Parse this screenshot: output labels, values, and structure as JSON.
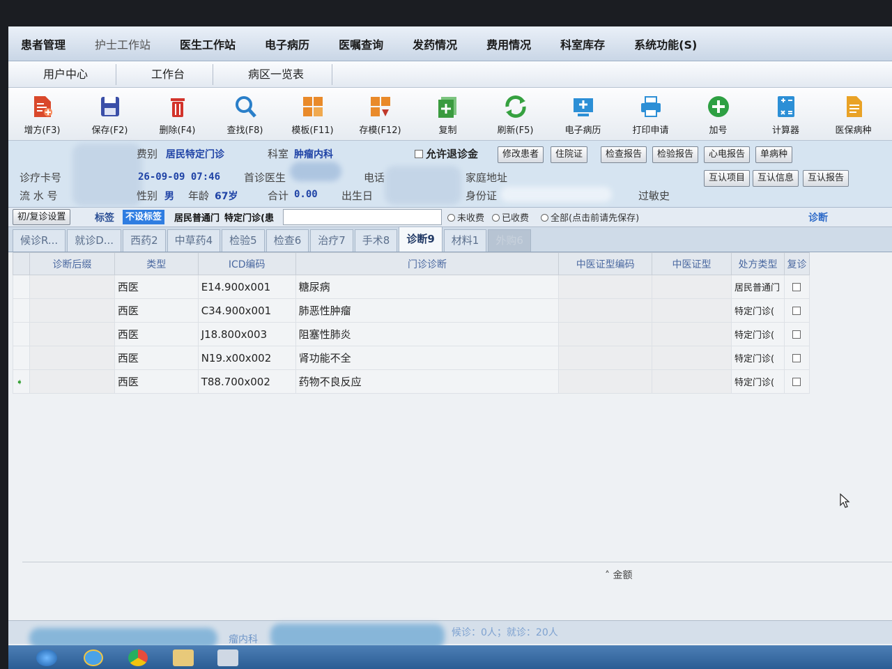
{
  "menu": {
    "items": [
      "患者管理",
      "护士工作站",
      "医生工作站",
      "电子病历",
      "医嘱查询",
      "发药情况",
      "费用情况",
      "科室库存",
      "系统功能(S)"
    ]
  },
  "subtabs": [
    "用户中心",
    "工作台",
    "病区一览表"
  ],
  "toolbar": [
    {
      "label": "增方(F3)",
      "icon": "add-prescription-icon",
      "color": "#d9482b"
    },
    {
      "label": "保存(F2)",
      "icon": "save-icon",
      "color": "#3b4fa8"
    },
    {
      "label": "删除(F4)",
      "icon": "delete-trash-icon",
      "color": "#d2332b"
    },
    {
      "label": "查找(F8)",
      "icon": "search-icon",
      "color": "#2a7fc9"
    },
    {
      "label": "模板(F11)",
      "icon": "template-icon",
      "color": "#e98a2a"
    },
    {
      "label": "存模(F12)",
      "icon": "save-template-icon",
      "color": "#e98a2a"
    },
    {
      "label": "复制",
      "icon": "copy-icon",
      "color": "#3a9b3f"
    },
    {
      "label": "刷新(F5)",
      "icon": "refresh-icon",
      "color": "#36a140"
    },
    {
      "label": "电子病历",
      "icon": "emr-icon",
      "color": "#2c8fd6"
    },
    {
      "label": "打印申请",
      "icon": "printer-icon",
      "color": "#2c8fd6"
    },
    {
      "label": "加号",
      "icon": "plus-circle-icon",
      "color": "#2ea043"
    },
    {
      "label": "计算器",
      "icon": "calculator-icon",
      "color": "#2c8fd6"
    },
    {
      "label": "医保病种",
      "icon": "insurance-doc-icon",
      "color": "#e9a226"
    }
  ],
  "patient": {
    "fee_type_label": "费别",
    "fee_type_value": "居民特定门诊",
    "dept_label": "科室",
    "dept_value": "肿瘤内科",
    "allow_refund_label": "允许退诊金",
    "card_label": "诊疗卡号",
    "serial_label": "流 水 号",
    "visit_time": "26-09-09 07:46",
    "first_doctor_label": "首诊医生",
    "phone_label": "电话",
    "address_label": "家庭地址",
    "gender_label": "性别",
    "gender_value": "男",
    "age_label": "年龄",
    "age_value": "67岁",
    "total_label": "合计",
    "total_value": "0.00",
    "birth_label": "出生日",
    "id_label": "身份证",
    "allergy_label": "过敏史",
    "buttons_row1": [
      "修改患者",
      "住院证",
      "检查报告",
      "检验报告",
      "心电报告",
      "单病种"
    ],
    "buttons_row2": [
      "互认项目",
      "互认信息",
      "互认报告"
    ]
  },
  "filter": {
    "visit_setting": "初/复诊设置",
    "tag_label": "标签",
    "tag_value": "不设标签",
    "type1": "居民普通门",
    "type2": "特定门诊(患",
    "unpaid": "未收费",
    "paid": "已收费",
    "all": "全部(点击前请先保存)",
    "diagnosis_link": "诊断"
  },
  "section_tabs": [
    {
      "label": "候诊R...",
      "state": "normal"
    },
    {
      "label": "就诊D...",
      "state": "normal"
    },
    {
      "label": "西药2",
      "state": "normal"
    },
    {
      "label": "中草药4",
      "state": "normal"
    },
    {
      "label": "检验5",
      "state": "normal"
    },
    {
      "label": "检查6",
      "state": "normal"
    },
    {
      "label": "治疗7",
      "state": "normal"
    },
    {
      "label": "手术8",
      "state": "normal"
    },
    {
      "label": "诊断9",
      "state": "active"
    },
    {
      "label": "材料1",
      "state": "normal"
    },
    {
      "label": "外购6",
      "state": "disabled"
    }
  ],
  "grid": {
    "headers": [
      "",
      "诊断后缀",
      "类型",
      "ICD编码",
      "门诊诊断",
      "中医证型编码",
      "中医证型",
      "处方类型",
      "复诊"
    ],
    "rows": [
      {
        "type": "西医",
        "icd": "E14.900x001",
        "diag": "糖尿病",
        "rx": "居民普通门",
        "current": false
      },
      {
        "type": "西医",
        "icd": "C34.900x001",
        "diag": "肺恶性肿瘤",
        "rx": "特定门诊(",
        "current": false
      },
      {
        "type": "西医",
        "icd": "J18.800x003",
        "diag": "阻塞性肺炎",
        "rx": "特定门诊(",
        "current": false
      },
      {
        "type": "西医",
        "icd": "N19.x00x002",
        "diag": "肾功能不全",
        "rx": "特定门诊(",
        "current": false
      },
      {
        "type": "西医",
        "icd": "T88.700x002",
        "diag": "药物不良反应",
        "rx": "特定门诊(",
        "current": true
      }
    ]
  },
  "footer": {
    "amount_label": "金额"
  },
  "status": {
    "dept": "瘤内科",
    "queue": "候诊：0人；就诊：20人"
  }
}
